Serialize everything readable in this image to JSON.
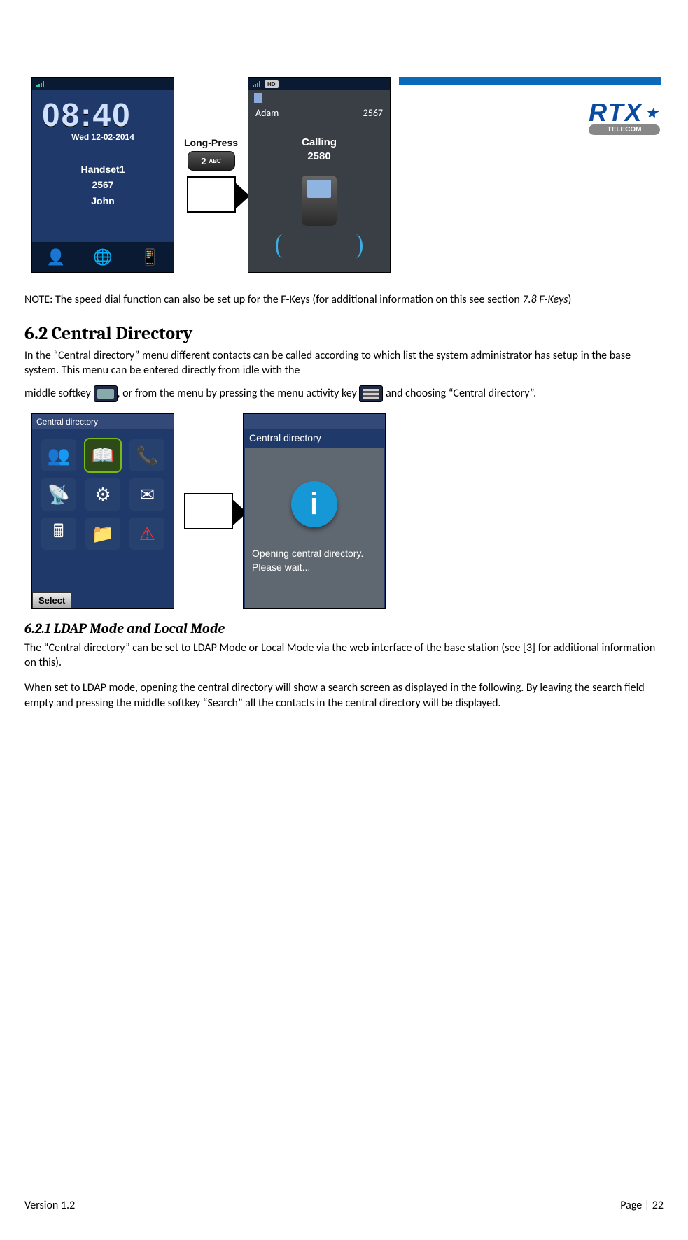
{
  "logo": {
    "text": "RTX",
    "sub": "TELECOM"
  },
  "idle_screen": {
    "time": "08:40",
    "date": "Wed 12-02-2014",
    "line1": "Handset1",
    "line2": "2567",
    "line3": "John"
  },
  "longpress": {
    "label": "Long-Press",
    "key": "2",
    "key_sub": "ABC"
  },
  "call_screen": {
    "hd": "HD",
    "name": "Adam",
    "number": "2567",
    "status1": "Calling",
    "status2": "2580"
  },
  "note": {
    "lead": "NOTE:",
    "body1": " The speed dial function can also be set up for the F-Keys (for additional information on this see section ",
    "ref": "7.8 F-Keys",
    "body2": ")"
  },
  "h2": "6.2 Central Directory",
  "p1a": "In the “Central directory” menu different contacts can be called according to which list the system administrator has setup in the base system. This menu can be entered directly from idle with the",
  "p1b": "middle softkey ",
  "p1c": ", or from the menu by pressing the menu activity key ",
  "p1d": " and choosing “Central directory”.",
  "menu_title": "Central directory",
  "select_label": "Select",
  "cd_screen": {
    "title": "Central directory",
    "msg1": "Opening central directory.",
    "msg2": "Please wait..."
  },
  "h3": "6.2.1 LDAP Mode and Local Mode",
  "p2": "The “Central directory” can be set to LDAP Mode or Local Mode via the web interface of the base station (see [3] for additional information on this).",
  "p3": "When set to LDAP mode, opening the central directory will show a search screen as displayed in the following. By leaving the search field empty and pressing the middle softkey “Search” all the contacts in the central directory will be displayed.",
  "footer": {
    "left": "Version 1.2",
    "right": "Page | 22"
  }
}
